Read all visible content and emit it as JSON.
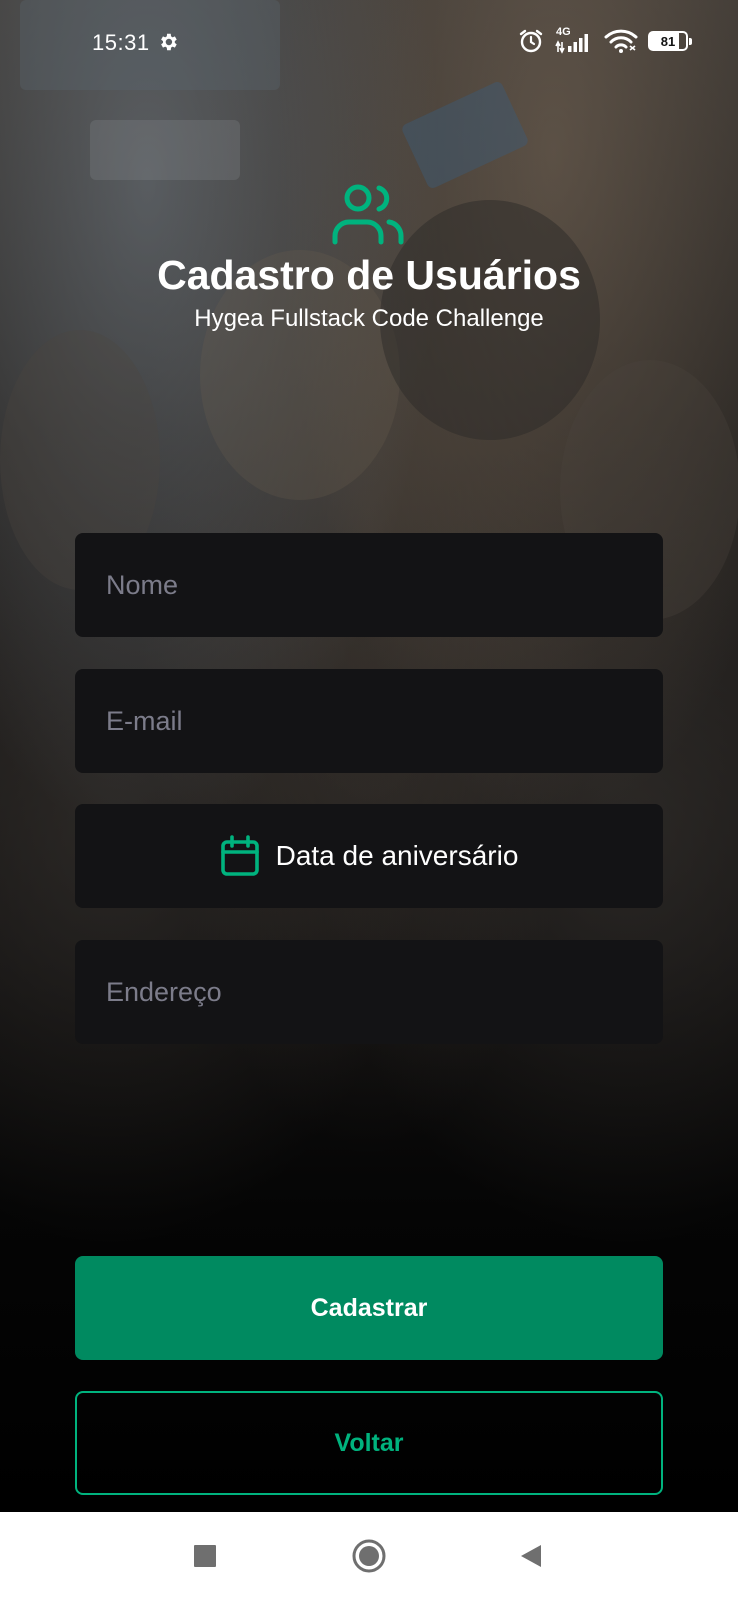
{
  "status_bar": {
    "time": "15:31",
    "network": "4G",
    "battery": "81"
  },
  "header": {
    "title": "Cadastro de Usuários",
    "subtitle": "Hygea Fullstack Code Challenge",
    "icon": "users-icon"
  },
  "form": {
    "name_placeholder": "Nome",
    "email_placeholder": "E-mail",
    "birthday_label": "Data de aniversário",
    "address_placeholder": "Endereço"
  },
  "actions": {
    "submit_label": "Cadastrar",
    "back_label": "Voltar"
  },
  "nav_bar": {
    "recents_icon": "square-icon",
    "home_icon": "circle-icon",
    "back_icon": "triangle-back-icon"
  },
  "colors": {
    "accent": "#00B37E",
    "primary_button": "#008A60",
    "field_background": "#131315",
    "placeholder": "#7C7C8A"
  }
}
